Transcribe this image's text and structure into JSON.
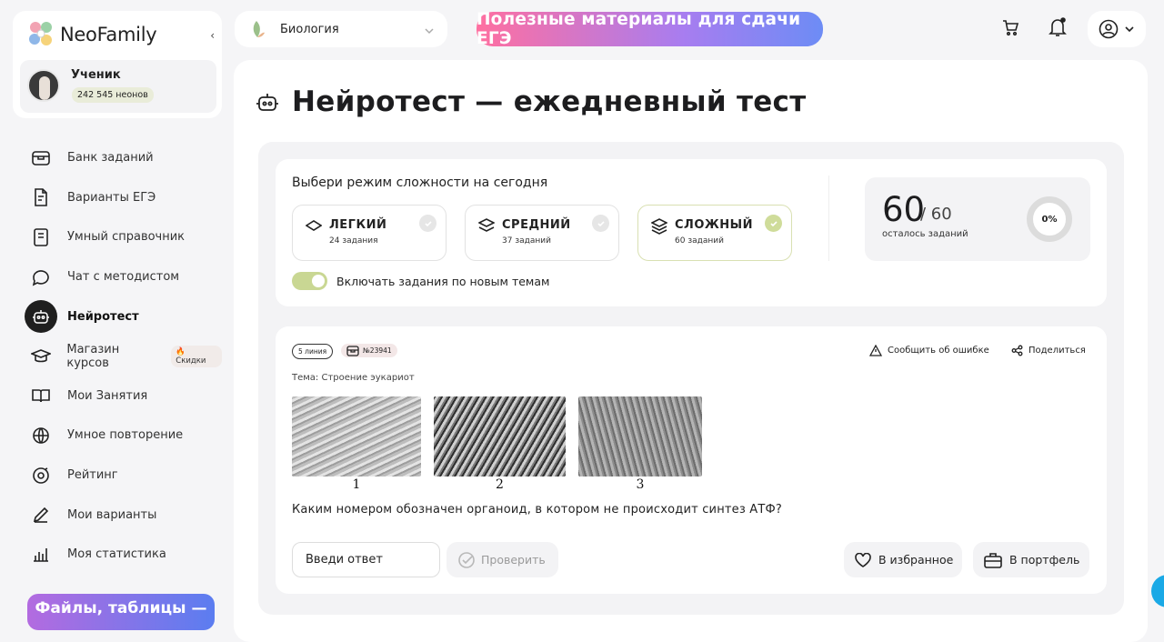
{
  "brand": {
    "name": "NeoFamily"
  },
  "user": {
    "role": "Ученик",
    "neons": "242 545 неонов"
  },
  "sidebar": {
    "items": [
      {
        "label": "Банк заданий",
        "icon": "bank-icon"
      },
      {
        "label": "Варианты ЕГЭ",
        "icon": "variants-icon"
      },
      {
        "label": "Умный справочник",
        "icon": "book-icon"
      },
      {
        "label": "Чат с методистом",
        "icon": "chat-icon"
      },
      {
        "label": "Нейротест",
        "icon": "robot-icon",
        "active": true
      },
      {
        "label": "Магазин курсов",
        "icon": "graduation-cap-icon",
        "badge": "Скидки"
      },
      {
        "label": "Мои Занятия",
        "icon": "open-book-icon"
      },
      {
        "label": "Умное повторение",
        "icon": "globe-icon"
      },
      {
        "label": "Рейтинг",
        "icon": "rating-icon"
      },
      {
        "label": "Мои варианты",
        "icon": "pencil-icon"
      },
      {
        "label": "Моя статистика",
        "icon": "bar-chart-icon"
      }
    ],
    "promo": "Файлы, таблицы —"
  },
  "topbar": {
    "subject": "Биология",
    "promo": "Полезные материалы для сдачи ЕГЭ"
  },
  "page": {
    "title": "Нейротест — ежедневный тест"
  },
  "mode": {
    "title": "Выбери режим сложности на сегодня",
    "levels": [
      {
        "name": "ЛЕГКИЙ",
        "count": "24 задания",
        "selected": false
      },
      {
        "name": "СРЕДНИЙ",
        "count": "37 заданий",
        "selected": false
      },
      {
        "name": "СЛОЖНЫЙ",
        "count": "60 заданий",
        "selected": true
      }
    ],
    "toggle_label": "Включать задания по новым темам",
    "toggle_on": true
  },
  "counter": {
    "remaining": "60",
    "total": "/ 60",
    "label": "осталось заданий",
    "percent": "0%",
    "progress": 0
  },
  "task": {
    "line": "5 линия",
    "number": "№23941",
    "report": "Сообщить об ошибке",
    "share": "Поделиться",
    "topic": "Тема: Строение эукариот",
    "figures": [
      "1",
      "2",
      "3"
    ],
    "question": "Каким номером обозначен органоид, в котором не происходит синтез АТФ?",
    "answer_placeholder": "Введи ответ",
    "check": "Проверить",
    "favorite": "В избранное",
    "portfolio": "В портфель"
  }
}
